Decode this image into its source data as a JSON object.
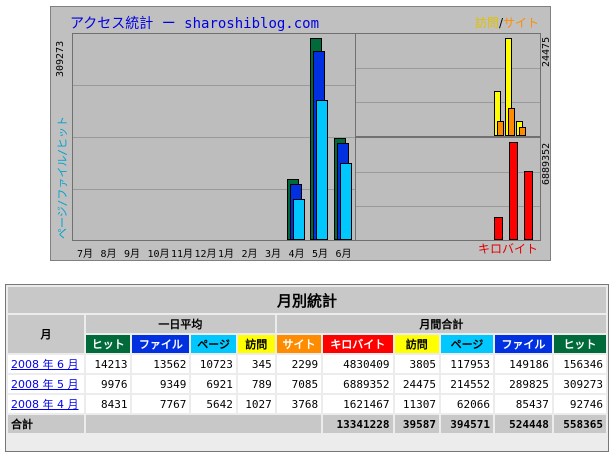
{
  "chart": {
    "title": "アクセス統計 ー sharoshiblog.com",
    "legend_visit": "訪問",
    "legend_sep": "/",
    "legend_site": "サイト",
    "left_vertical_label": "ページ/ファイル/ヒット",
    "left_scale_value": "309273",
    "right_top_scale_value": "24475",
    "right_bottom_scale_value": "6889352",
    "bottom_right_label": "キロバイト"
  },
  "chart_data": {
    "type": "bar",
    "categories": [
      "7月",
      "8月",
      "9月",
      "10月",
      "11月",
      "12月",
      "1月",
      "2月",
      "3月",
      "4月",
      "5月",
      "6月"
    ],
    "series": [
      {
        "name": "ヒット",
        "values": [
          0,
          0,
          0,
          0,
          0,
          0,
          0,
          0,
          0,
          92746,
          309273,
          156346
        ]
      },
      {
        "name": "ファイル",
        "values": [
          0,
          0,
          0,
          0,
          0,
          0,
          0,
          0,
          0,
          85437,
          289825,
          149186
        ]
      },
      {
        "name": "ページ",
        "values": [
          0,
          0,
          0,
          0,
          0,
          0,
          0,
          0,
          0,
          62066,
          214552,
          117953
        ]
      }
    ],
    "right_top": {
      "categories": [
        "4月",
        "5月",
        "6月"
      ],
      "series": [
        {
          "name": "訪問",
          "values": [
            11307,
            24475,
            3805
          ]
        },
        {
          "name": "サイト",
          "values": [
            3768,
            7085,
            2299
          ]
        }
      ]
    },
    "right_bottom": {
      "categories": [
        "4月",
        "5月",
        "6月"
      ],
      "series": [
        {
          "name": "キロバイト",
          "values": [
            1621467,
            6889352,
            4830409
          ]
        }
      ]
    },
    "colors": {
      "hit": "#006a3a",
      "file": "#0030e0",
      "page": "#00c8ff",
      "visit": "#ffff00",
      "site": "#ff8c00",
      "kb": "#ff0000"
    }
  },
  "table": {
    "title": "月別統計",
    "col_month": "月",
    "group_daily": "一日平均",
    "group_monthly": "月間合計",
    "h_hit": "ヒット",
    "h_file": "ファイル",
    "h_page": "ページ",
    "h_visit": "訪問",
    "h_site": "サイト",
    "h_kb": "キロバイト",
    "rows": [
      {
        "month": "2008 年 6 月",
        "d_hit": "14213",
        "d_file": "13562",
        "d_page": "10723",
        "d_visit": "345",
        "site": "2299",
        "kb": "4830409",
        "visit": "3805",
        "page": "117953",
        "file": "149186",
        "hit": "156346"
      },
      {
        "month": "2008 年 5 月",
        "d_hit": "9976",
        "d_file": "9349",
        "d_page": "6921",
        "d_visit": "789",
        "site": "7085",
        "kb": "6889352",
        "visit": "24475",
        "page": "214552",
        "file": "289825",
        "hit": "309273"
      },
      {
        "month": "2008 年 4 月",
        "d_hit": "8431",
        "d_file": "7767",
        "d_page": "5642",
        "d_visit": "1027",
        "site": "3768",
        "kb": "1621467",
        "visit": "11307",
        "page": "62066",
        "file": "85437",
        "hit": "92746"
      }
    ],
    "total_label": "合計",
    "total": {
      "kb": "13341228",
      "visit": "39587",
      "page": "394571",
      "file": "524448",
      "hit": "558365"
    }
  }
}
